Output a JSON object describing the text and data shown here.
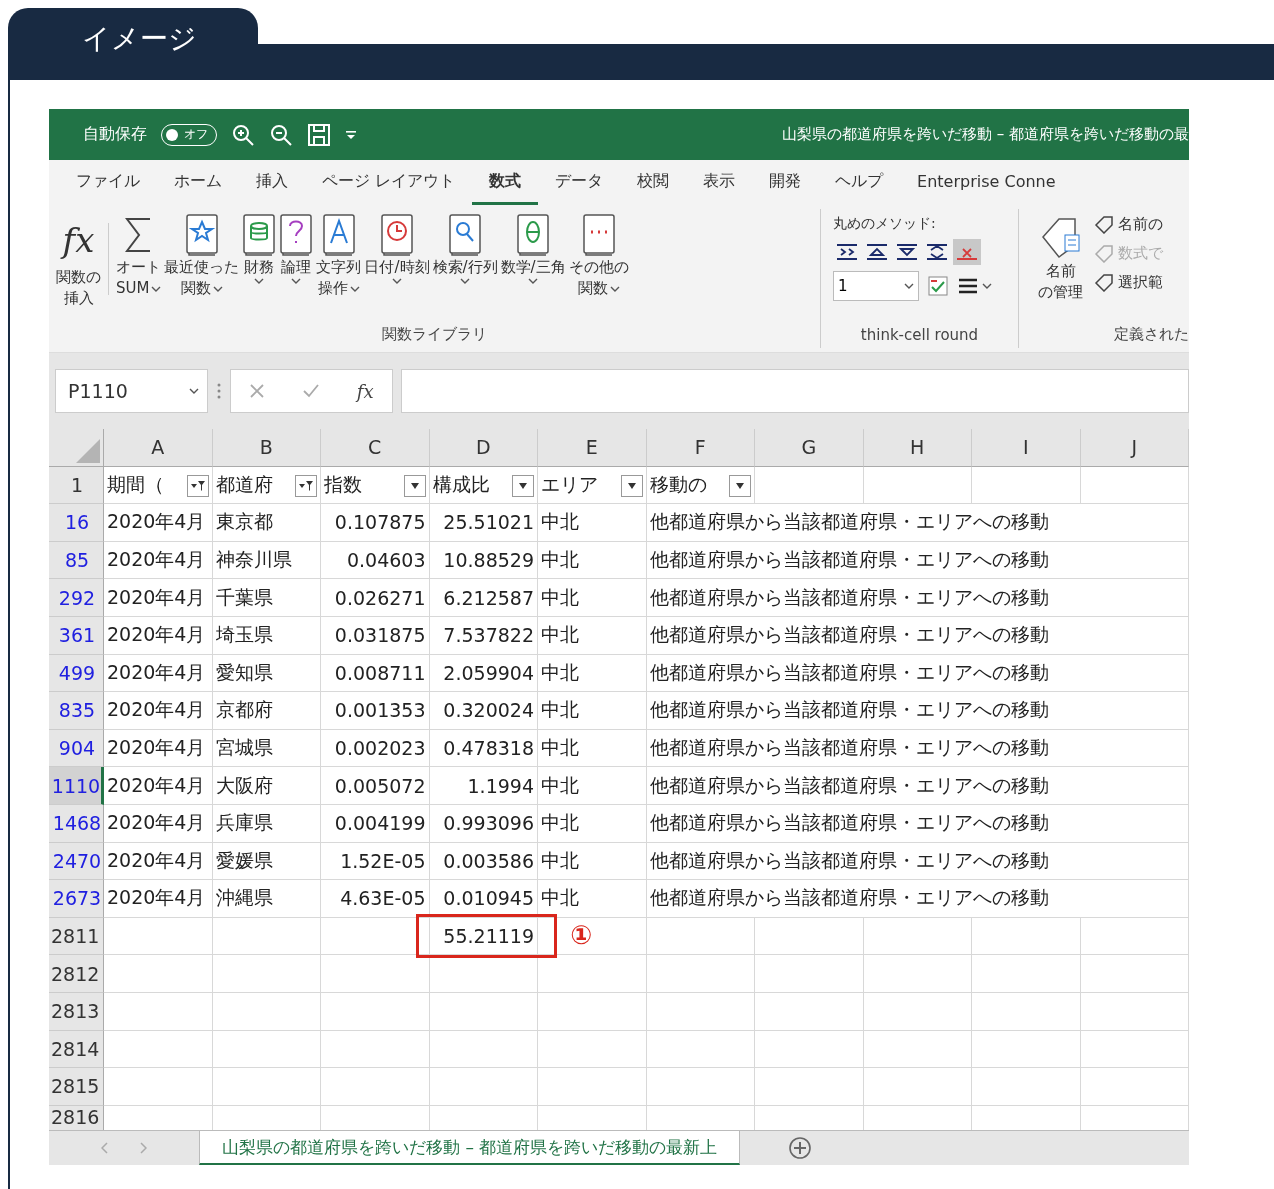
{
  "page_tab": "イメージ",
  "excel": {
    "quick_access": {
      "autosave_label": "自動保存",
      "autosave_on": false,
      "toggle_label": "オフ"
    },
    "title": "山梨県の都道府県を跨いだ移動 – 都道府県を跨いだ移動の最",
    "ribbon_tabs": [
      {
        "label": "ファイル",
        "selected": false
      },
      {
        "label": "ホーム",
        "selected": false
      },
      {
        "label": "挿入",
        "selected": false
      },
      {
        "label": "ページ レイアウト",
        "selected": false
      },
      {
        "label": "数式",
        "selected": true
      },
      {
        "label": "データ",
        "selected": false
      },
      {
        "label": "校閲",
        "selected": false
      },
      {
        "label": "表示",
        "selected": false
      },
      {
        "label": "開発",
        "selected": false
      },
      {
        "label": "ヘルプ",
        "selected": false
      },
      {
        "label": "Enterprise Conne",
        "selected": false
      }
    ],
    "function_library": {
      "glyph": "fx",
      "label": "関数ライブラリ",
      "buttons": [
        {
          "lines": [
            "関数の",
            "挿入"
          ],
          "menu": false
        },
        {
          "lines": [
            "オート",
            "SUM"
          ],
          "menu": true
        },
        {
          "lines": [
            "最近使った",
            "関数"
          ],
          "menu": true
        },
        {
          "lines": [
            "財務"
          ],
          "menu": true
        },
        {
          "lines": [
            "論理"
          ],
          "menu": true
        },
        {
          "lines": [
            "文字列",
            "操作"
          ],
          "menu": true
        },
        {
          "lines": [
            "日付/時刻"
          ],
          "menu": true
        },
        {
          "lines": [
            "検索/行列"
          ],
          "menu": true
        },
        {
          "lines": [
            "数学/三角"
          ],
          "menu": true
        },
        {
          "lines": [
            "その他の",
            "関数"
          ],
          "menu": true
        }
      ]
    },
    "think_cell": {
      "heading": "丸めのメソッド:",
      "value": "1",
      "label": "think-cell round",
      "tools": [
        {
          "selected": false
        },
        {
          "selected": false
        },
        {
          "selected": false
        },
        {
          "selected": false
        },
        {
          "selected": true
        }
      ]
    },
    "defined_names": {
      "label": "定義された",
      "manager": [
        "名前",
        "の管理"
      ],
      "items": [
        {
          "text": "名前の",
          "disabled": false
        },
        {
          "text": "数式で",
          "disabled": true
        },
        {
          "text": "選択範",
          "disabled": false
        }
      ]
    },
    "name_box": "P1110",
    "formula_glyph": "fx",
    "columns": [
      "A",
      "B",
      "C",
      "D",
      "E",
      "F",
      "G",
      "H",
      "I",
      "J"
    ],
    "header_row": {
      "num": "1",
      "cells": [
        {
          "text": "期間（",
          "filtered": true
        },
        {
          "text": "都道府",
          "filtered": true
        },
        {
          "text": "指数",
          "filtered": false
        },
        {
          "text": "構成比",
          "filtered": false
        },
        {
          "text": "エリア",
          "filtered": false
        },
        {
          "text": "移動の",
          "filtered": false
        }
      ]
    },
    "rows": [
      {
        "num": "16",
        "filtered": true,
        "selected": false,
        "values": [
          "2020年4月",
          "東京都",
          "0.107875",
          "25.51021",
          "中北",
          "他都道府県から当該都道府県・エリアへの移動"
        ]
      },
      {
        "num": "85",
        "filtered": true,
        "selected": false,
        "values": [
          "2020年4月",
          "神奈川県",
          "0.04603",
          "10.88529",
          "中北",
          "他都道府県から当該都道府県・エリアへの移動"
        ]
      },
      {
        "num": "292",
        "filtered": true,
        "selected": false,
        "values": [
          "2020年4月",
          "千葉県",
          "0.026271",
          "6.212587",
          "中北",
          "他都道府県から当該都道府県・エリアへの移動"
        ]
      },
      {
        "num": "361",
        "filtered": true,
        "selected": false,
        "values": [
          "2020年4月",
          "埼玉県",
          "0.031875",
          "7.537822",
          "中北",
          "他都道府県から当該都道府県・エリアへの移動"
        ]
      },
      {
        "num": "499",
        "filtered": true,
        "selected": false,
        "values": [
          "2020年4月",
          "愛知県",
          "0.008711",
          "2.059904",
          "中北",
          "他都道府県から当該都道府県・エリアへの移動"
        ]
      },
      {
        "num": "835",
        "filtered": true,
        "selected": false,
        "values": [
          "2020年4月",
          "京都府",
          "0.001353",
          "0.320024",
          "中北",
          "他都道府県から当該都道府県・エリアへの移動"
        ]
      },
      {
        "num": "904",
        "filtered": true,
        "selected": false,
        "values": [
          "2020年4月",
          "宮城県",
          "0.002023",
          "0.478318",
          "中北",
          "他都道府県から当該都道府県・エリアへの移動"
        ]
      },
      {
        "num": "1110",
        "filtered": true,
        "selected": true,
        "values": [
          "2020年4月",
          "大阪府",
          "0.005072",
          "1.1994",
          "中北",
          "他都道府県から当該都道府県・エリアへの移動"
        ]
      },
      {
        "num": "1468",
        "filtered": true,
        "selected": false,
        "values": [
          "2020年4月",
          "兵庫県",
          "0.004199",
          "0.993096",
          "中北",
          "他都道府県から当該都道府県・エリアへの移動"
        ]
      },
      {
        "num": "2470",
        "filtered": true,
        "selected": false,
        "values": [
          "2020年4月",
          "愛媛県",
          "1.52E-05",
          "0.003586",
          "中北",
          "他都道府県から当該都道府県・エリアへの移動"
        ]
      },
      {
        "num": "2673",
        "filtered": true,
        "selected": false,
        "values": [
          "2020年4月",
          "沖縄県",
          "4.63E-05",
          "0.010945",
          "中北",
          "他都道府県から当該都道府県・エリアへの移動"
        ]
      },
      {
        "num": "2811",
        "filtered": false,
        "selected": false,
        "total": "55.21119",
        "callout": "①"
      },
      {
        "num": "2812",
        "filtered": false,
        "selected": false
      },
      {
        "num": "2813",
        "filtered": false,
        "selected": false
      },
      {
        "num": "2814",
        "filtered": false,
        "selected": false
      },
      {
        "num": "2815",
        "filtered": false,
        "selected": false
      },
      {
        "num": "2816",
        "filtered": false,
        "selected": false
      }
    ],
    "sheet_tabs": [
      {
        "label": "山梨県の都道府県を跨いだ移動 – 都道府県を跨いだ移動の最新上",
        "selected": true
      }
    ]
  }
}
